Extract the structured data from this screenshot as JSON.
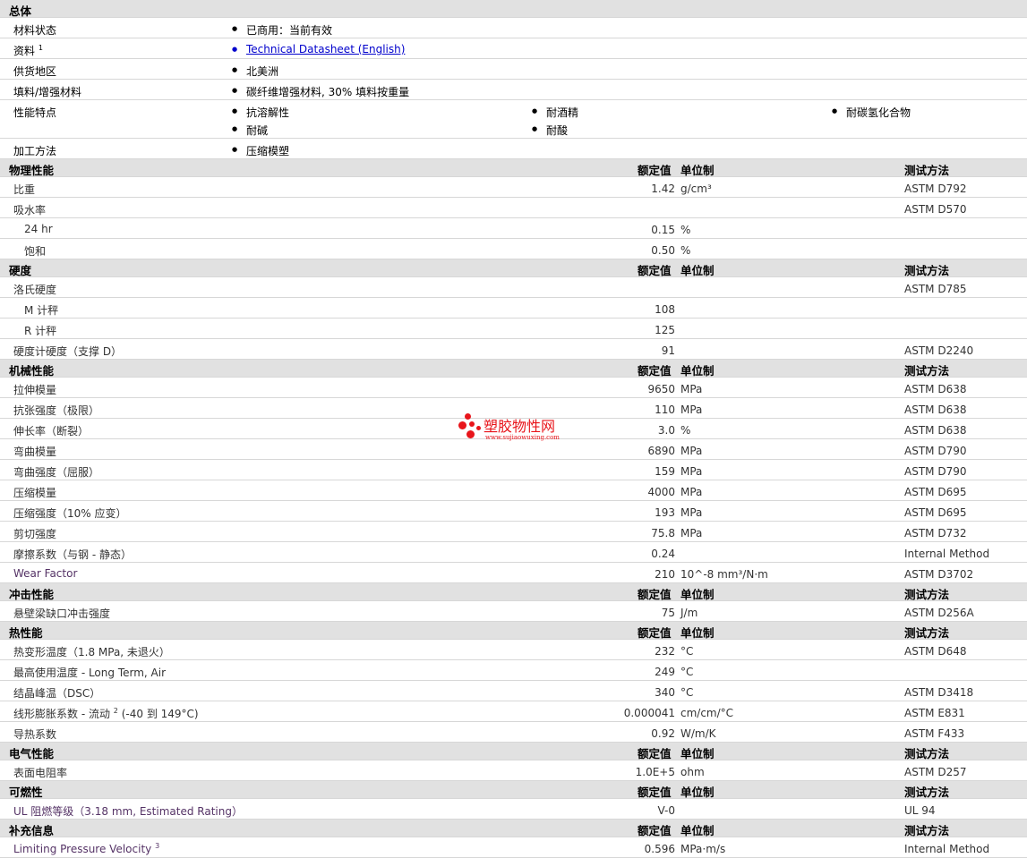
{
  "general": {
    "title": "总体",
    "rows": [
      {
        "label": "材料状态",
        "items": [
          "已商用：当前有效"
        ]
      },
      {
        "label": "资料",
        "sup": "1",
        "link": "Technical Datasheet (English)"
      },
      {
        "label": "供货地区",
        "items": [
          "北美洲"
        ]
      },
      {
        "label": "填料/增强材料",
        "items": [
          "碳纤维增强材料, 30% 填料按重量"
        ]
      },
      {
        "label": "性能特点",
        "items": [
          "抗溶解性",
          "耐酒精",
          "耐碳氢化合物",
          "耐碱",
          "耐酸"
        ]
      },
      {
        "label": "加工方法",
        "items": [
          "压缩模塑"
        ]
      }
    ]
  },
  "headers": {
    "value": "额定值",
    "unit": "单位制",
    "test": "测试方法"
  },
  "sections": [
    {
      "title": "物理性能",
      "rows": [
        {
          "label": "比重",
          "value": "1.42",
          "unit": "g/cm³",
          "test": "ASTM D792"
        },
        {
          "label": "吸水率",
          "value": "",
          "unit": "",
          "test": "ASTM D570"
        },
        {
          "label": "24 hr",
          "value": "0.15",
          "unit": "%",
          "test": ""
        },
        {
          "label": "饱和",
          "value": "0.50",
          "unit": "%",
          "test": ""
        }
      ]
    },
    {
      "title": "硬度",
      "rows": [
        {
          "label": "洛氏硬度",
          "value": "",
          "unit": "",
          "test": "ASTM D785"
        },
        {
          "label": "M 计秤",
          "value": "108",
          "unit": "",
          "test": ""
        },
        {
          "label": "R 计秤",
          "value": "125",
          "unit": "",
          "test": ""
        },
        {
          "label": "硬度计硬度（支撑 D）",
          "value": "91",
          "unit": "",
          "test": "ASTM D2240"
        }
      ]
    },
    {
      "title": "机械性能",
      "rows": [
        {
          "label": "拉伸模量",
          "value": "9650",
          "unit": "MPa",
          "test": "ASTM D638"
        },
        {
          "label": "抗张强度（极限）",
          "value": "110",
          "unit": "MPa",
          "test": "ASTM D638"
        },
        {
          "label": "伸长率（断裂）",
          "value": "3.0",
          "unit": "%",
          "test": "ASTM D638"
        },
        {
          "label": "弯曲模量",
          "value": "6890",
          "unit": "MPa",
          "test": "ASTM D790"
        },
        {
          "label": "弯曲强度（屈服）",
          "value": "159",
          "unit": "MPa",
          "test": "ASTM D790"
        },
        {
          "label": "压缩模量",
          "value": "4000",
          "unit": "MPa",
          "test": "ASTM D695"
        },
        {
          "label": "压缩强度（10% 应变）",
          "value": "193",
          "unit": "MPa",
          "test": "ASTM D695"
        },
        {
          "label": "剪切强度",
          "value": "75.8",
          "unit": "MPa",
          "test": "ASTM D732"
        },
        {
          "label": "摩擦系数（与钢 - 静态）",
          "value": "0.24",
          "unit": "",
          "test": "Internal Method"
        },
        {
          "label": "Wear Factor",
          "value": "210",
          "unit": "10^-8 mm³/N·m",
          "test": "ASTM D3702"
        }
      ]
    },
    {
      "title": "冲击性能",
      "rows": [
        {
          "label": "悬壁梁缺口冲击强度",
          "value": "75",
          "unit": "J/m",
          "test": "ASTM D256A"
        }
      ]
    },
    {
      "title": "热性能",
      "rows": [
        {
          "label": "热变形温度（1.8 MPa, 未退火）",
          "value": "232",
          "unit": "°C",
          "test": "ASTM D648"
        },
        {
          "label": "最高使用温度 - Long Term, Air",
          "value": "249",
          "unit": "°C",
          "test": ""
        },
        {
          "label": "结晶峰温（DSC）",
          "value": "340",
          "unit": "°C",
          "test": "ASTM D3418"
        },
        {
          "label": "线形膨胀系数 - 流动",
          "sup": "2",
          "label2": "(-40 到 149°C)",
          "value": "0.000041",
          "unit": "cm/cm/°C",
          "test": "ASTM E831"
        },
        {
          "label": "导热系数",
          "value": "0.92",
          "unit": "W/m/K",
          "test": "ASTM F433"
        }
      ]
    },
    {
      "title": "电气性能",
      "rows": [
        {
          "label": "表面电阻率",
          "value": "1.0E+5",
          "unit": "ohm",
          "test": "ASTM D257"
        }
      ]
    },
    {
      "title": "可燃性",
      "rows": [
        {
          "label": "UL 阻燃等级（3.18 mm, Estimated Rating）",
          "value": "V-0",
          "unit": "",
          "test": "UL 94"
        }
      ]
    },
    {
      "title": "补充信息",
      "rows": [
        {
          "label": "Limiting Pressure Velocity",
          "sup": "3",
          "value": "0.596",
          "unit": "MPa·m/s",
          "test": "Internal Method"
        }
      ]
    }
  ],
  "watermark": {
    "text": "塑胶物性网",
    "url": "www.sujiaowuxing.com"
  }
}
